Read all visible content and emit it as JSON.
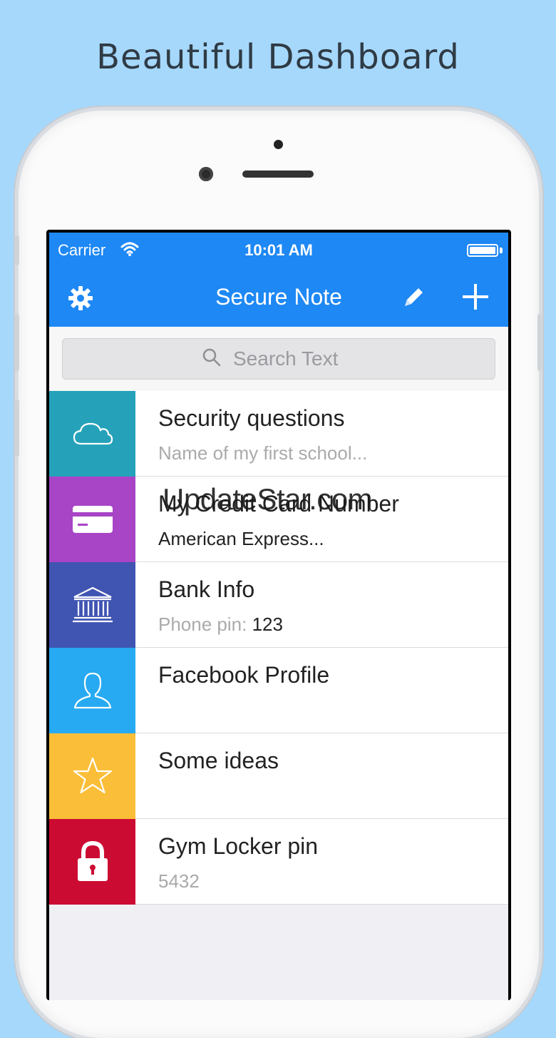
{
  "headline": "Beautiful Dashboard",
  "status_bar": {
    "carrier": "Carrier",
    "time": "10:01 AM"
  },
  "navbar": {
    "title": "Secure Note",
    "icons": [
      "gear-icon",
      "pencil-icon",
      "plus-icon"
    ]
  },
  "search": {
    "placeholder": "Search Text"
  },
  "notes": [
    {
      "title": "Security questions",
      "subtitle": "Name of my first school...",
      "color": "#25a2ba",
      "icon": "cloud-icon"
    },
    {
      "title": "My Credit Card Number",
      "subtitle": "American Express...",
      "color": "#a844c6",
      "icon": "credit-card-icon"
    },
    {
      "title": "Bank Info",
      "subtitle_label": "Phone pin: ",
      "subtitle_value": "123",
      "color": "#4054b2",
      "icon": "bank-icon"
    },
    {
      "title": "Facebook Profile",
      "subtitle": "",
      "color": "#27aaf1",
      "icon": "user-icon"
    },
    {
      "title": "Some ideas",
      "subtitle": "",
      "color": "#fbbe38",
      "icon": "star-icon"
    },
    {
      "title": "Gym Locker pin",
      "subtitle": "5432",
      "color": "#cc0b32",
      "icon": "lock-icon"
    }
  ],
  "watermark": "UpdateStar.com"
}
